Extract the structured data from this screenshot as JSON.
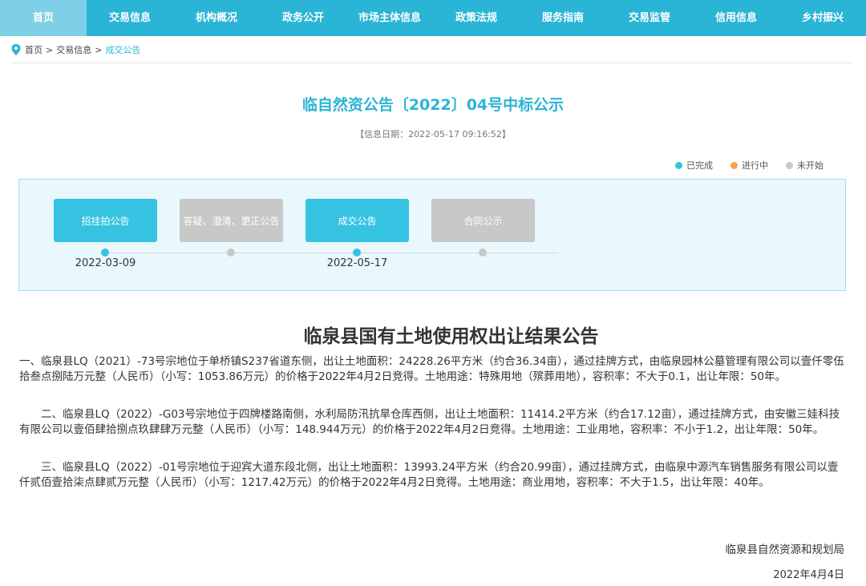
{
  "nav": {
    "items": [
      {
        "label": "首页"
      },
      {
        "label": "交易信息"
      },
      {
        "label": "机构概况"
      },
      {
        "label": "政务公开"
      },
      {
        "label": "市场主体信息"
      },
      {
        "label": "政策法规"
      },
      {
        "label": "服务指南"
      },
      {
        "label": "交易监管"
      },
      {
        "label": "信用信息"
      },
      {
        "label": "乡村振兴"
      }
    ],
    "active_index": 0
  },
  "breadcrumb": {
    "items": [
      "首页",
      "交易信息",
      "成交公告"
    ],
    "separator": ">"
  },
  "announcement": {
    "title": "临自然资公告〔2022〕04号中标公示",
    "info_date": "【信息日期：2022-05-17 09:16:52】"
  },
  "legend": {
    "items": [
      {
        "label": "已完成",
        "color": "#36c3e2"
      },
      {
        "label": "进行中",
        "color": "#f7a24a"
      },
      {
        "label": "未开始",
        "color": "#c8c8c8"
      }
    ]
  },
  "progress": {
    "steps": [
      {
        "label": "招挂拍公告",
        "status": "done",
        "date": "2022-03-09"
      },
      {
        "label": "答疑、澄清、更正公告",
        "status": "pending",
        "date": ""
      },
      {
        "label": "成交公告",
        "status": "done",
        "date": "2022-05-17"
      },
      {
        "label": "合同公示",
        "status": "pending",
        "date": ""
      }
    ]
  },
  "document": {
    "title": "临泉县国有土地使用权出让结果公告",
    "paragraphs": [
      "一、临泉县LQ（2021）-73号宗地位于单桥镇S237省道东侧，出让土地面积：24228.26平方米（约合36.34亩），通过挂牌方式，由临泉园林公墓管理有限公司以壹仟零伍拾叁点捌陆万元整（人民币）（小写：1053.86万元）的价格于2022年4月2日竞得。土地用途：特殊用地（殡葬用地），容积率：不大于0.1，出让年限：50年。",
      "二、临泉县LQ（2022）-G03号宗地位于四牌楼路南侧，水利局防汛抗旱仓库西侧，出让土地面积：11414.2平方米（约合17.12亩），通过挂牌方式，由安徽三娃科技有限公司以壹佰肆拾捌点玖肆肆万元整（人民币）（小写：148.944万元）的价格于2022年4月2日竞得。土地用途：工业用地，容积率：不小于1.2，出让年限：50年。",
      "三、临泉县LQ（2022）-01号宗地位于迎宾大道东段北侧，出让土地面积：13993.24平方米（约合20.99亩），通过挂牌方式，由临泉中源汽车销售服务有限公司以壹仟贰佰壹拾柒点肆贰万元整（人民币）（小写：1217.42万元）的价格于2022年4月2日竞得。土地用途：商业用地，容积率：不大于1.5，出让年限：40年。"
    ],
    "signature": "临泉县自然资源和规划局",
    "date": "2022年4月4日"
  }
}
